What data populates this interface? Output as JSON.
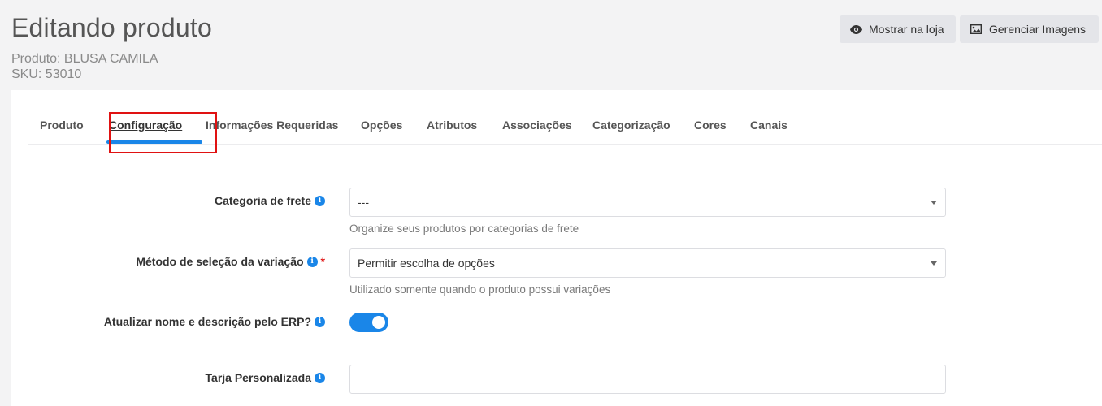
{
  "header": {
    "title": "Editando produto",
    "product_line": "Produto: BLUSA CAMILA",
    "sku_line": "SKU: 53010",
    "buttons": {
      "show_in_store": "Mostrar na loja",
      "manage_images": "Gerenciar Imagens"
    }
  },
  "tabs": [
    {
      "label": "Produto",
      "active": false
    },
    {
      "label": "Configuração",
      "active": true
    },
    {
      "label": "Informações Requeridas",
      "active": false
    },
    {
      "label": "Opções",
      "active": false
    },
    {
      "label": "Atributos",
      "active": false
    },
    {
      "label": "Associações",
      "active": false
    },
    {
      "label": "Categorização",
      "active": false
    },
    {
      "label": "Cores",
      "active": false
    },
    {
      "label": "Canais",
      "active": false
    }
  ],
  "form": {
    "shipping_category": {
      "label": "Categoria de frete",
      "value": "---",
      "help": "Organize seus produtos por categorias de frete"
    },
    "variation_method": {
      "label": "Método de seleção da variação",
      "required_mark": "*",
      "value": "Permitir escolha de opções",
      "help": "Utilizado somente quando o produto possui variações"
    },
    "erp_update": {
      "label": "Atualizar nome e descrição pelo ERP?",
      "enabled": true
    },
    "custom_banner": {
      "label": "Tarja Personalizada",
      "value": ""
    }
  },
  "icons": {
    "info": "i"
  },
  "colors": {
    "accent": "#1a86e8",
    "highlight": "#e01212",
    "background": "#f3f3f4"
  }
}
